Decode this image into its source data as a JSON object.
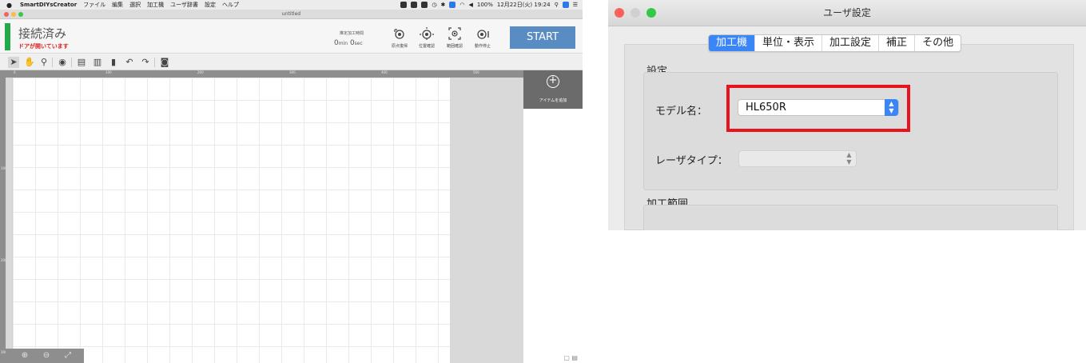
{
  "left_app": {
    "menubar": {
      "apple": "",
      "app_name": "SmartDIYsCreator",
      "items": [
        "ファイル",
        "編集",
        "選択",
        "加工機",
        "ユーザ辞書",
        "設定",
        "ヘルプ"
      ],
      "status_text": "100% ",
      "datetime": "12月22日(火) 19:24"
    },
    "window_title": "untitled",
    "header": {
      "connection_status": "接続済み",
      "door_status": "ドアが開いています",
      "time_label": "推定加工時間",
      "time_min": "0",
      "time_min_unit": "min",
      "time_sec": "0",
      "time_sec_unit": "sec",
      "buttons": [
        {
          "label": "原点復帰",
          "icon": "home-origin-icon"
        },
        {
          "label": "位置確認",
          "icon": "position-check-icon"
        },
        {
          "label": "範囲確認",
          "icon": "range-check-icon"
        },
        {
          "label": "動作停止",
          "icon": "stop-motion-icon"
        }
      ],
      "start_label": "START"
    },
    "ruler": {
      "top_ticks": [
        "0",
        "100",
        "200",
        "300",
        "400",
        "500"
      ],
      "left_ticks": [
        "100",
        "200",
        "300"
      ]
    },
    "add_item_label": "アイテムを追加"
  },
  "settings": {
    "title": "ユーザ設定",
    "tabs": [
      "加工機",
      "単位・表示",
      "加工設定",
      "補正",
      "その他"
    ],
    "active_tab": "加工機",
    "group_settings_label": "設定",
    "model_label": "モデル名：",
    "model_value": "HL650R",
    "laser_type_label": "レーザタイプ：",
    "laser_type_value": "",
    "group_range_label": "加工範囲",
    "colors": {
      "accent": "#3b86f7",
      "highlight": "#e8141c",
      "start_button": "#5a8cc4",
      "connected": "#21a94a",
      "door_warning": "#e02020"
    }
  }
}
